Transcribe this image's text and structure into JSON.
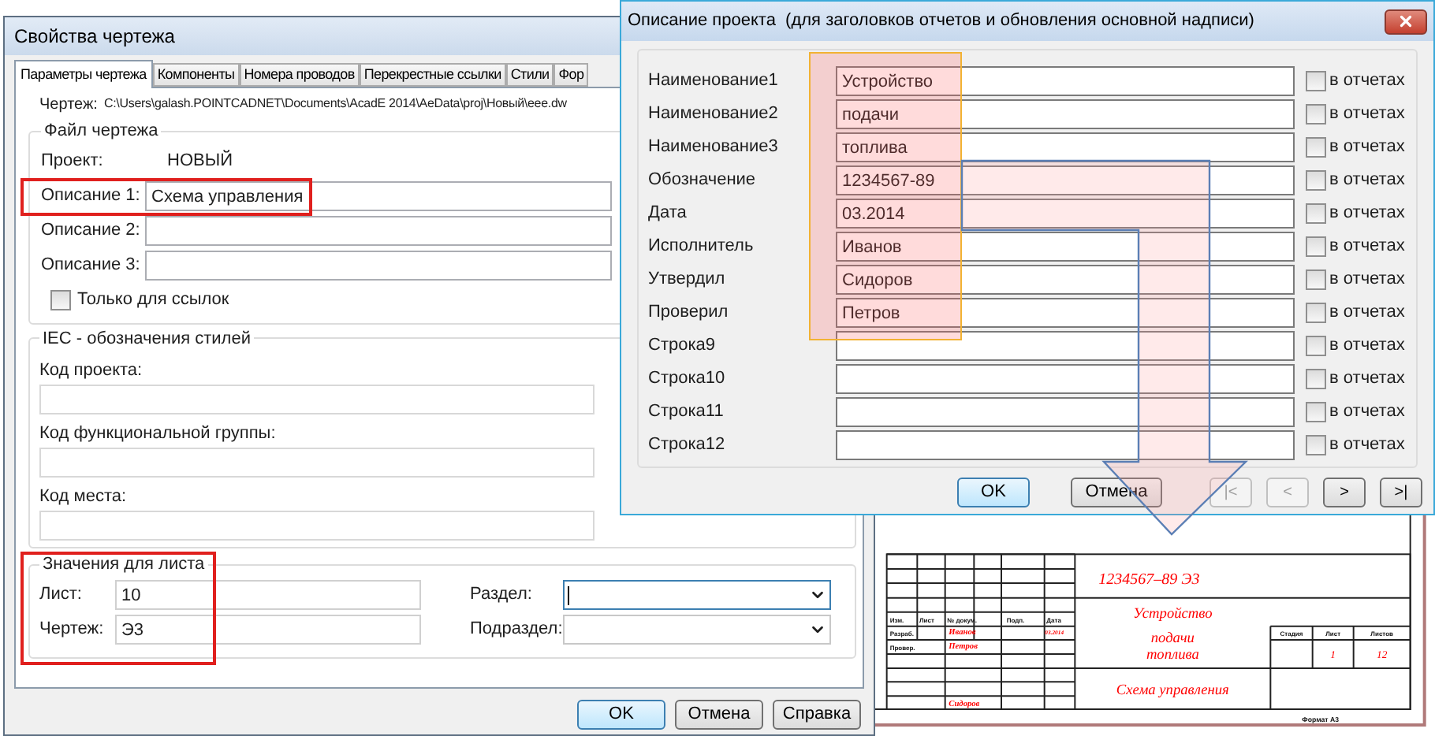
{
  "annotations": {
    "description_frame": true,
    "sheet_frame": true,
    "highlight_column": true,
    "callout_arrow": true
  },
  "drawing_properties": {
    "title": "Свойства чертежа",
    "tabs": [
      {
        "label": "Параметры чертежа",
        "selected": true
      },
      {
        "label": "Компоненты",
        "selected": false
      },
      {
        "label": "Номера проводов",
        "selected": false
      },
      {
        "label": "Перекрестные ссылки",
        "selected": false
      },
      {
        "label": "Стили",
        "selected": false
      },
      {
        "label": "Фор",
        "selected": false
      }
    ],
    "path_label": "Чертеж:",
    "path": "C:\\Users\\galash.POINTCADNET\\Documents\\AcadE 2014\\AeData\\proj\\Новый\\eee.dw",
    "file_group": {
      "title": "Файл чертежа",
      "project_label": "Проект:",
      "project": "НОВЫЙ",
      "descriptions": [
        {
          "label": "Описание 1:",
          "value": "Схема управления"
        },
        {
          "label": "Описание 2:"
        },
        {
          "label": "Описание 3:"
        }
      ],
      "reference_only": {
        "label": "Только для ссылок",
        "checked": false
      }
    },
    "iec_group": {
      "title": "IEC - обозначения стилей",
      "fields": [
        {
          "label": "Код проекта:"
        },
        {
          "label": "Код функциональной группы:"
        },
        {
          "label": "Код места:"
        }
      ]
    },
    "sheet_group": {
      "title": "Значения для листа",
      "fields": [
        {
          "label": "Лист:",
          "value": "10"
        },
        {
          "label": "Чертеж:",
          "value": "Э3"
        }
      ],
      "combos": [
        {
          "label": "Раздел:",
          "focused": true
        },
        {
          "label": "Подраздел:",
          "focused": false
        }
      ]
    },
    "buttons": [
      {
        "label": "OK",
        "default": true
      },
      {
        "label": "Отмена",
        "default": false
      },
      {
        "label": "Справка",
        "default": false
      }
    ]
  },
  "project_description": {
    "title": "Описание проекта  (для заголовков отчетов и обновления основной надписи)",
    "rows": [
      {
        "label": "Наименование1",
        "value": "Устройство",
        "report": {
          "label": "в отчетах",
          "checked": false
        }
      },
      {
        "label": "Наименование2",
        "value": "подачи",
        "report": {
          "label": "в отчетах",
          "checked": false
        }
      },
      {
        "label": "Наименование3",
        "value": "топлива",
        "report": {
          "label": "в отчетах",
          "checked": false
        }
      },
      {
        "label": "Обозначение",
        "value": "1234567-89",
        "report": {
          "label": "в отчетах",
          "checked": false
        }
      },
      {
        "label": "Дата",
        "value": "03.2014",
        "report": {
          "label": "в отчетах",
          "checked": false
        }
      },
      {
        "label": "Исполнитель",
        "value": "Иванов",
        "report": {
          "label": "в отчетах",
          "checked": false
        }
      },
      {
        "label": "Утвердил",
        "value": "Сидоров",
        "report": {
          "label": "в отчетах",
          "checked": false
        }
      },
      {
        "label": "Проверил",
        "value": "Петров",
        "report": {
          "label": "в отчетах",
          "checked": false
        }
      },
      {
        "label": "Строка9",
        "report": {
          "label": "в отчетах",
          "checked": false
        }
      },
      {
        "label": "Строка10",
        "report": {
          "label": "в отчетах",
          "checked": false
        }
      },
      {
        "label": "Строка11",
        "report": {
          "label": "в отчетах",
          "checked": false
        }
      },
      {
        "label": "Строка12",
        "report": {
          "label": "в отчетах",
          "checked": false
        }
      }
    ],
    "buttons": [
      {
        "label": "OK",
        "default": true
      },
      {
        "label": "Отмена",
        "default": false
      }
    ],
    "nav_buttons": [
      {
        "label": "|<",
        "disabled": true
      },
      {
        "label": "<",
        "disabled": true
      },
      {
        "label": ">",
        "disabled": false
      },
      {
        "label": ">|",
        "disabled": false
      }
    ]
  },
  "title_block": {
    "designation": "1234567–89 Э3",
    "name_lines": [
      "Устройство",
      "подачи",
      "топлива"
    ],
    "title": "Схема управления",
    "columns": [
      "Изм.",
      "Лист",
      "№ докум.",
      "Подп.",
      "Дата"
    ],
    "signatures": [
      {
        "role": "Разраб.",
        "name": "Иванов",
        "date": "03.2014"
      },
      {
        "role": "Провер.",
        "name": "Петров"
      },
      {
        "name": "Сидоров"
      }
    ],
    "stage_columns": [
      "Стадия",
      "Лист",
      "Листов"
    ],
    "sheet": "1",
    "sheets": "12",
    "format": "Формат А3"
  }
}
